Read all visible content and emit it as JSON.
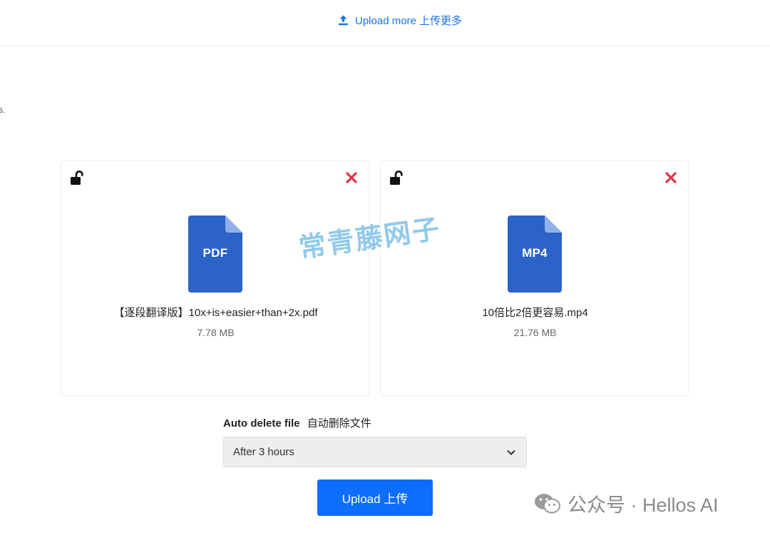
{
  "header": {
    "upload_more_label": "Upload more  上传更多",
    "upload_icon": "upload-icon"
  },
  "fragment_text": "s.",
  "files": [
    {
      "name": "【逐段翻译版】10x+is+easier+than+2x.pdf",
      "size": "7.78 MB",
      "type_label": "PDF",
      "lock_icon": "unlock-icon",
      "remove_icon": "close-icon"
    },
    {
      "name": "10倍比2倍更容易.mp4",
      "size": "21.76 MB",
      "type_label": "MP4",
      "lock_icon": "unlock-icon",
      "remove_icon": "close-icon"
    }
  ],
  "auto_delete": {
    "label_en": "Auto delete file",
    "label_zh": "自动删除文件",
    "selected": "After 3 hours"
  },
  "upload_button_label": "Upload  上传",
  "watermarks": {
    "center": "常青藤网子",
    "badge": "公众号 · Hellos AI"
  },
  "colors": {
    "accent": "#0d6efd",
    "link": "#1a73e8",
    "danger": "#dc3545",
    "file_icon": "#2b63c6",
    "watermark": "#87c4e8"
  }
}
